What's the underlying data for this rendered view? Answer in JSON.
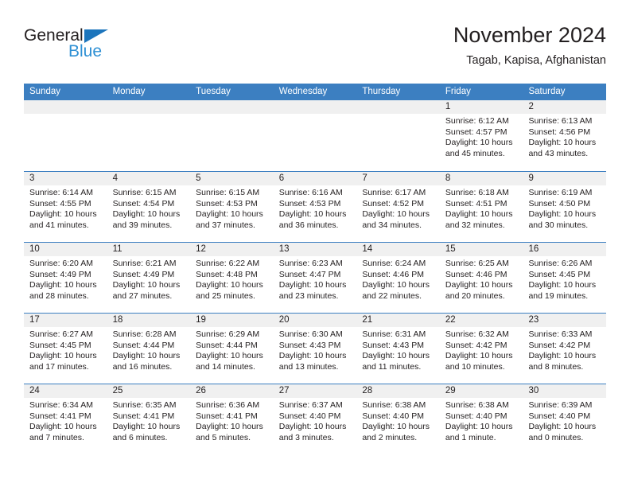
{
  "brand": {
    "name_part1": "General",
    "name_part2": "Blue",
    "triangle_color": "#1c75bc",
    "blue_color": "#2e90d4"
  },
  "header": {
    "title": "November 2024",
    "subtitle": "Tagab, Kapisa, Afghanistan"
  },
  "theme": {
    "header_blue": "#3c7fc1",
    "day_head_gray": "#f0f0f0",
    "text_color": "#231f20"
  },
  "weekdays": [
    "Sunday",
    "Monday",
    "Tuesday",
    "Wednesday",
    "Thursday",
    "Friday",
    "Saturday"
  ],
  "weeks": [
    [
      {
        "date": "",
        "empty": true
      },
      {
        "date": "",
        "empty": true
      },
      {
        "date": "",
        "empty": true
      },
      {
        "date": "",
        "empty": true
      },
      {
        "date": "",
        "empty": true
      },
      {
        "date": "1",
        "sunrise": "Sunrise: 6:12 AM",
        "sunset": "Sunset: 4:57 PM",
        "daylight1": "Daylight: 10 hours",
        "daylight2": "and 45 minutes."
      },
      {
        "date": "2",
        "sunrise": "Sunrise: 6:13 AM",
        "sunset": "Sunset: 4:56 PM",
        "daylight1": "Daylight: 10 hours",
        "daylight2": "and 43 minutes."
      }
    ],
    [
      {
        "date": "3",
        "sunrise": "Sunrise: 6:14 AM",
        "sunset": "Sunset: 4:55 PM",
        "daylight1": "Daylight: 10 hours",
        "daylight2": "and 41 minutes."
      },
      {
        "date": "4",
        "sunrise": "Sunrise: 6:15 AM",
        "sunset": "Sunset: 4:54 PM",
        "daylight1": "Daylight: 10 hours",
        "daylight2": "and 39 minutes."
      },
      {
        "date": "5",
        "sunrise": "Sunrise: 6:15 AM",
        "sunset": "Sunset: 4:53 PM",
        "daylight1": "Daylight: 10 hours",
        "daylight2": "and 37 minutes."
      },
      {
        "date": "6",
        "sunrise": "Sunrise: 6:16 AM",
        "sunset": "Sunset: 4:53 PM",
        "daylight1": "Daylight: 10 hours",
        "daylight2": "and 36 minutes."
      },
      {
        "date": "7",
        "sunrise": "Sunrise: 6:17 AM",
        "sunset": "Sunset: 4:52 PM",
        "daylight1": "Daylight: 10 hours",
        "daylight2": "and 34 minutes."
      },
      {
        "date": "8",
        "sunrise": "Sunrise: 6:18 AM",
        "sunset": "Sunset: 4:51 PM",
        "daylight1": "Daylight: 10 hours",
        "daylight2": "and 32 minutes."
      },
      {
        "date": "9",
        "sunrise": "Sunrise: 6:19 AM",
        "sunset": "Sunset: 4:50 PM",
        "daylight1": "Daylight: 10 hours",
        "daylight2": "and 30 minutes."
      }
    ],
    [
      {
        "date": "10",
        "sunrise": "Sunrise: 6:20 AM",
        "sunset": "Sunset: 4:49 PM",
        "daylight1": "Daylight: 10 hours",
        "daylight2": "and 28 minutes."
      },
      {
        "date": "11",
        "sunrise": "Sunrise: 6:21 AM",
        "sunset": "Sunset: 4:49 PM",
        "daylight1": "Daylight: 10 hours",
        "daylight2": "and 27 minutes."
      },
      {
        "date": "12",
        "sunrise": "Sunrise: 6:22 AM",
        "sunset": "Sunset: 4:48 PM",
        "daylight1": "Daylight: 10 hours",
        "daylight2": "and 25 minutes."
      },
      {
        "date": "13",
        "sunrise": "Sunrise: 6:23 AM",
        "sunset": "Sunset: 4:47 PM",
        "daylight1": "Daylight: 10 hours",
        "daylight2": "and 23 minutes."
      },
      {
        "date": "14",
        "sunrise": "Sunrise: 6:24 AM",
        "sunset": "Sunset: 4:46 PM",
        "daylight1": "Daylight: 10 hours",
        "daylight2": "and 22 minutes."
      },
      {
        "date": "15",
        "sunrise": "Sunrise: 6:25 AM",
        "sunset": "Sunset: 4:46 PM",
        "daylight1": "Daylight: 10 hours",
        "daylight2": "and 20 minutes."
      },
      {
        "date": "16",
        "sunrise": "Sunrise: 6:26 AM",
        "sunset": "Sunset: 4:45 PM",
        "daylight1": "Daylight: 10 hours",
        "daylight2": "and 19 minutes."
      }
    ],
    [
      {
        "date": "17",
        "sunrise": "Sunrise: 6:27 AM",
        "sunset": "Sunset: 4:45 PM",
        "daylight1": "Daylight: 10 hours",
        "daylight2": "and 17 minutes."
      },
      {
        "date": "18",
        "sunrise": "Sunrise: 6:28 AM",
        "sunset": "Sunset: 4:44 PM",
        "daylight1": "Daylight: 10 hours",
        "daylight2": "and 16 minutes."
      },
      {
        "date": "19",
        "sunrise": "Sunrise: 6:29 AM",
        "sunset": "Sunset: 4:44 PM",
        "daylight1": "Daylight: 10 hours",
        "daylight2": "and 14 minutes."
      },
      {
        "date": "20",
        "sunrise": "Sunrise: 6:30 AM",
        "sunset": "Sunset: 4:43 PM",
        "daylight1": "Daylight: 10 hours",
        "daylight2": "and 13 minutes."
      },
      {
        "date": "21",
        "sunrise": "Sunrise: 6:31 AM",
        "sunset": "Sunset: 4:43 PM",
        "daylight1": "Daylight: 10 hours",
        "daylight2": "and 11 minutes."
      },
      {
        "date": "22",
        "sunrise": "Sunrise: 6:32 AM",
        "sunset": "Sunset: 4:42 PM",
        "daylight1": "Daylight: 10 hours",
        "daylight2": "and 10 minutes."
      },
      {
        "date": "23",
        "sunrise": "Sunrise: 6:33 AM",
        "sunset": "Sunset: 4:42 PM",
        "daylight1": "Daylight: 10 hours",
        "daylight2": "and 8 minutes."
      }
    ],
    [
      {
        "date": "24",
        "sunrise": "Sunrise: 6:34 AM",
        "sunset": "Sunset: 4:41 PM",
        "daylight1": "Daylight: 10 hours",
        "daylight2": "and 7 minutes."
      },
      {
        "date": "25",
        "sunrise": "Sunrise: 6:35 AM",
        "sunset": "Sunset: 4:41 PM",
        "daylight1": "Daylight: 10 hours",
        "daylight2": "and 6 minutes."
      },
      {
        "date": "26",
        "sunrise": "Sunrise: 6:36 AM",
        "sunset": "Sunset: 4:41 PM",
        "daylight1": "Daylight: 10 hours",
        "daylight2": "and 5 minutes."
      },
      {
        "date": "27",
        "sunrise": "Sunrise: 6:37 AM",
        "sunset": "Sunset: 4:40 PM",
        "daylight1": "Daylight: 10 hours",
        "daylight2": "and 3 minutes."
      },
      {
        "date": "28",
        "sunrise": "Sunrise: 6:38 AM",
        "sunset": "Sunset: 4:40 PM",
        "daylight1": "Daylight: 10 hours",
        "daylight2": "and 2 minutes."
      },
      {
        "date": "29",
        "sunrise": "Sunrise: 6:38 AM",
        "sunset": "Sunset: 4:40 PM",
        "daylight1": "Daylight: 10 hours",
        "daylight2": "and 1 minute."
      },
      {
        "date": "30",
        "sunrise": "Sunrise: 6:39 AM",
        "sunset": "Sunset: 4:40 PM",
        "daylight1": "Daylight: 10 hours",
        "daylight2": "and 0 minutes."
      }
    ]
  ]
}
